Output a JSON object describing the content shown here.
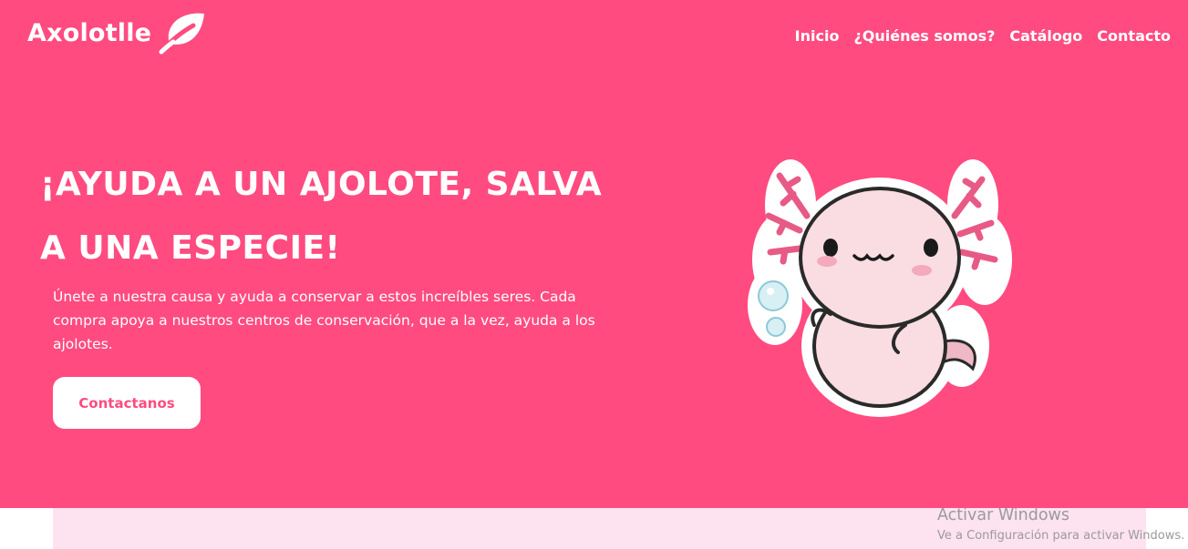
{
  "brand": {
    "name": "Axolotlle",
    "icon": "leaf-icon"
  },
  "nav": {
    "items": [
      "Inicio",
      "¿Quiénes somos?",
      "Catálogo",
      "Contacto"
    ]
  },
  "hero": {
    "headline_line1": "¡AYUDA A UN AJOLOTE, SALVA",
    "headline_line2": "A UNA ESPECIE!",
    "body": "Únete a nuestra causa y ayuda a conservar a estos increíbles seres. Cada compra apoya a nuestros centros de conservación, que a la vez, ayuda a los ajolotes.",
    "cta_label": "Contactanos",
    "image": "axolotl-sticker-illustration"
  },
  "watermark": {
    "title": "Activar Windows",
    "subtitle": "Ve a Configuración para activar Windows."
  },
  "colors": {
    "hero_bg": "#ff4b80",
    "band_bg": "#fde3ef",
    "accent": "#ff4b80",
    "text_light": "#ffffff"
  }
}
